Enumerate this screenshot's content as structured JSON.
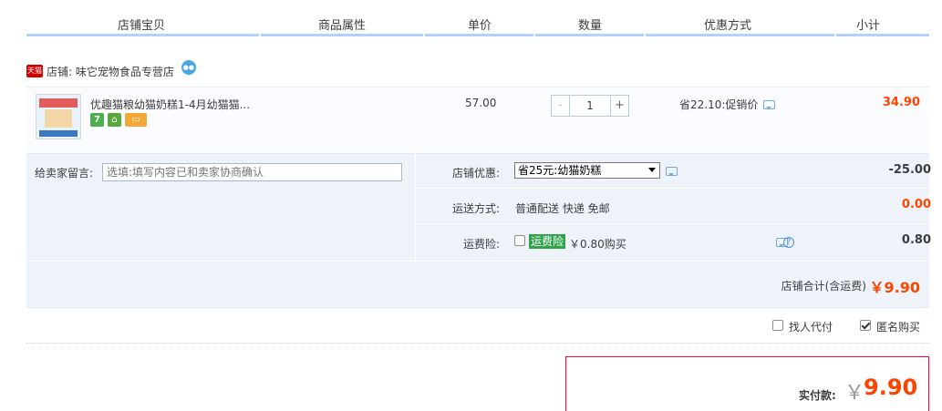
{
  "header": {
    "columns": [
      "店铺宝贝",
      "商品属性",
      "单价",
      "数量",
      "优惠方式",
      "小计"
    ]
  },
  "shop": {
    "badge": "天猫",
    "name": "店铺: 味它宠物食品专营店"
  },
  "item": {
    "title": "优趣猫粮幼猫奶糕1-4月幼猫猫...",
    "badge_7": "7",
    "unit_price": "57.00",
    "quantity": "1",
    "qty_minus": "-",
    "qty_plus": "+",
    "promotion": "省22.10:促销价",
    "subtotal": "34.90"
  },
  "order": {
    "message_label": "给卖家留言:",
    "message_placeholder": "选填:填写内容已和卖家协商确认",
    "shop_discount_label": "店铺优惠:",
    "shop_discount_selected": "省25元:幼猫奶糕",
    "shop_discount_amount": "-25.00",
    "shipping_label": "运送方式:",
    "shipping_value": "普通配送 快递 免邮",
    "shipping_amount": "0.00",
    "insurance_label": "运费险:",
    "insurance_tag": "运费险",
    "insurance_price": "￥0.80购买",
    "insurance_amount": "0.80",
    "help_icon": "?",
    "shop_total_label": "店铺合计(含运费)",
    "shop_total": "￥9.90"
  },
  "options": {
    "proxy_pay": "找人代付",
    "anonymous": "匿名购买"
  },
  "payment": {
    "label": "实付款:",
    "currency": "￥",
    "amount": "9.90"
  },
  "colors": {
    "accent_red": "#ff4400",
    "header_bar": "#b2d1ff",
    "panel_bg": "#eef3fa"
  }
}
